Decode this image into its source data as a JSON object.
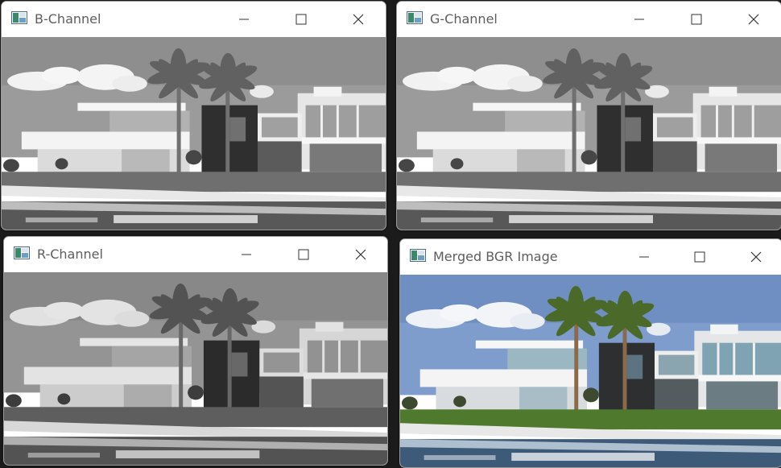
{
  "windows": [
    {
      "id": "b",
      "title": "B-Channel",
      "mode": "gray"
    },
    {
      "id": "g",
      "title": "G-Channel",
      "mode": "gray"
    },
    {
      "id": "r",
      "title": "R-Channel",
      "mode": "gray"
    },
    {
      "id": "merged",
      "title": "Merged BGR Image",
      "mode": "color"
    }
  ],
  "colors": {
    "window_bg": "#ffffff",
    "title_text": "#5d5d5d",
    "desktop": "#1b1b1b"
  },
  "icons": {
    "app": "opencv-window-icon",
    "minimize": "minimize-icon",
    "maximize": "maximize-icon",
    "close": "close-icon"
  }
}
